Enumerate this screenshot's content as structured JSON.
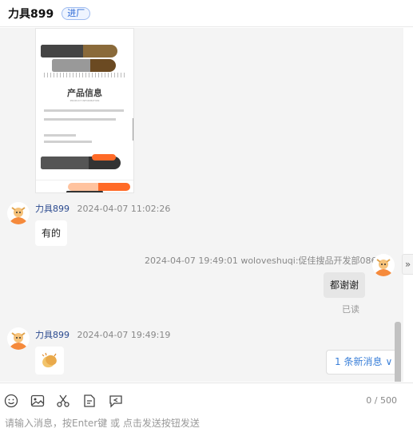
{
  "header": {
    "title": "力具899",
    "badge": "进厂"
  },
  "product_card": {
    "heading": "产品信息",
    "sub": "PRODUCT INFORMATION"
  },
  "messages": [
    {
      "sender": "力具899",
      "time": "2024-04-07 11:02:26",
      "text": "有的"
    },
    {
      "meta": "2024-04-07 19:49:01  woloveshuqi:促佳搜品开发部086",
      "text": "都谢谢",
      "status": "已读"
    },
    {
      "sender": "力具899",
      "time": "2024-04-07 19:49:19",
      "emoji": "clapping-hands"
    }
  ],
  "new_message": {
    "label": "1 条新消息"
  },
  "toolbar": {
    "icons": [
      "emoji-icon",
      "image-icon",
      "scissors-icon",
      "document-icon",
      "reply-icon"
    ],
    "counter": "0 / 500"
  },
  "input": {
    "placeholder": "请输入消息，按Enter键 或 点击发送按钮发送"
  },
  "colors": {
    "accent": "#3a7fd8",
    "sender": "#2b4a8f",
    "promo": "#ff6a27"
  }
}
